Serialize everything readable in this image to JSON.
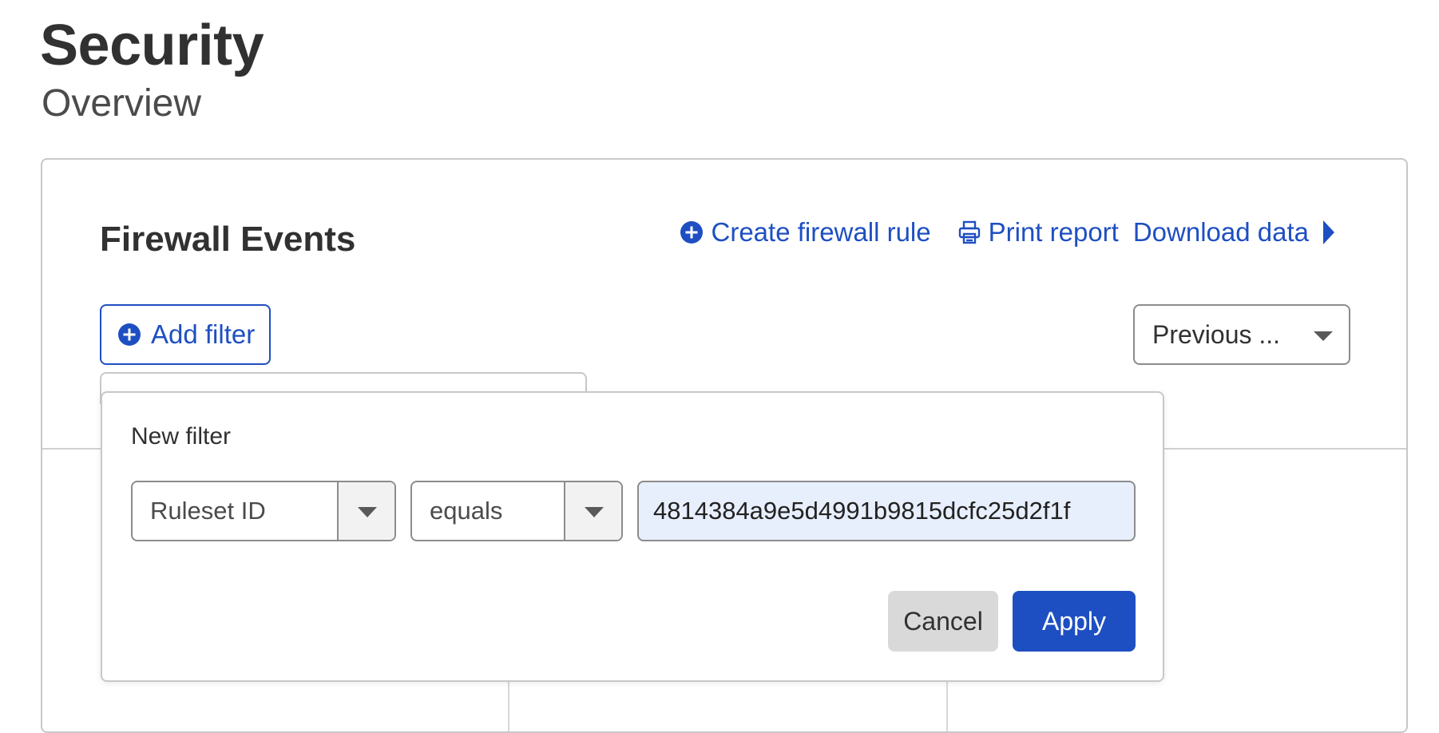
{
  "page": {
    "title": "Security",
    "subtitle": "Overview"
  },
  "card": {
    "title": "Firewall Events",
    "actions": {
      "create_rule_label": "Create firewall rule",
      "print_label": "Print report",
      "download_label": "Download data"
    },
    "add_filter_label": "Add filter",
    "time_range_value": "Previous ..."
  },
  "filter_popover": {
    "title": "New filter",
    "field_value": "Ruleset ID",
    "operator_value": "equals",
    "input_value": "4814384a9e5d4991b9815dcfc25d2f1f",
    "cancel_label": "Cancel",
    "apply_label": "Apply"
  },
  "icons": {
    "create": "plus-circle-icon",
    "print": "printer-icon",
    "download": "caret-right-icon",
    "add_filter": "plus-circle-icon"
  },
  "colors": {
    "accent": "#1e4fc2",
    "input_highlight": "#e8effc"
  }
}
